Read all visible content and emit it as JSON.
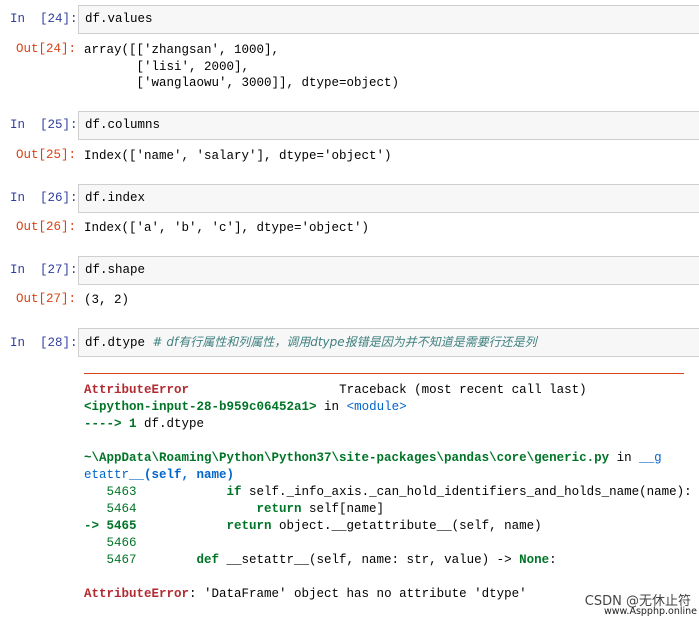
{
  "cells": [
    {
      "in_label": "In  [24]:",
      "code": "df.values",
      "out_label": "Out[24]:",
      "out_lines": [
        "array([['zhangsan', 1000],",
        "       ['lisi', 2000],",
        "       ['wanglaowu', 3000]], dtype=object)"
      ]
    },
    {
      "in_label": "In  [25]:",
      "code": "df.columns",
      "out_label": "Out[25]:",
      "out_lines": [
        "Index(['name', 'salary'], dtype='object')"
      ]
    },
    {
      "in_label": "In  [26]:",
      "code": "df.index",
      "out_label": "Out[26]:",
      "out_lines": [
        "Index(['a', 'b', 'c'], dtype='object')"
      ]
    },
    {
      "in_label": "In  [27]:",
      "code": "df.shape",
      "out_label": "Out[27]:",
      "out_lines": [
        "(3, 2)"
      ]
    },
    {
      "in_label": "In  [28]:",
      "code": "df.dtype ",
      "comment": "# df有行属性和列属性，调用dtype报错是因为并不知道是需要行还是列"
    }
  ],
  "traceback": {
    "error_name": "AttributeError",
    "header_right": "Traceback (most recent call last)",
    "input_ref": "<ipython-input-28-b959c06452a1>",
    "in_word": " in ",
    "module": "<module>",
    "arrow1": "----> 1 ",
    "arrow1_code": "df.dtype",
    "path": "~\\AppData\\Roaming\\Python\\Python37\\site-packages\\pandas\\core\\generic.py",
    "path_in": " in ",
    "func_a": "__g",
    "func_b": "etattr__",
    "func_sig": "(self, name)",
    "line5463_no": "   5463",
    "line5463_kw": "            if",
    "line5463_code": " self._info_axis._can_hold_identifiers_and_holds_name(name):",
    "line5464_no": "   5464",
    "line5464_kw": "                return",
    "line5464_code": " self[name]",
    "line5465_no": "-> 5465",
    "line5465_kw": "            return",
    "line5465_code": " object.__getattribute__(self, name)",
    "line5466_no": "   5466",
    "line5467_no": "   5467",
    "line5467_kw": "        def",
    "line5467_code": " __setattr__(self, name: str, value) -> ",
    "line5467_none": "None",
    "line5467_end": ":",
    "final_name": "AttributeError",
    "final_msg": ": 'DataFrame' object has no attribute 'dtype'"
  },
  "watermark": "CSDN @无休止符",
  "watermark2": "www.Aspphp.online"
}
